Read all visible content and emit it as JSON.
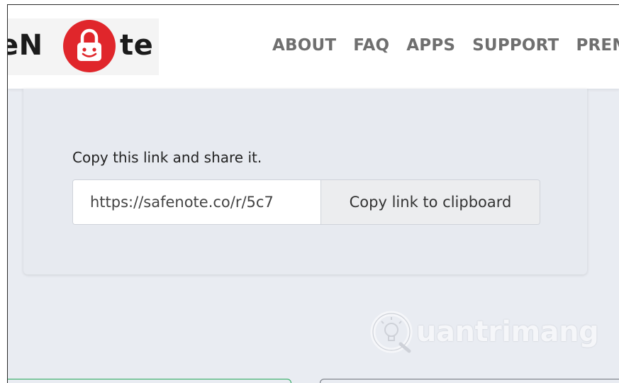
{
  "header": {
    "logo_left": "eN",
    "logo_right": "te",
    "nav": [
      "ABOUT",
      "FAQ",
      "APPS",
      "SUPPORT",
      "PREM"
    ]
  },
  "share": {
    "label": "Copy this link and share it.",
    "link_value": "https://safenote.co/r/5c7",
    "copy_button": "Copy link to clipboard"
  },
  "watermark": {
    "text": "uantrimang"
  },
  "colors": {
    "brand_red": "#e0262b",
    "nav_text": "#6f6f6f",
    "background": "#e9ecf2"
  }
}
